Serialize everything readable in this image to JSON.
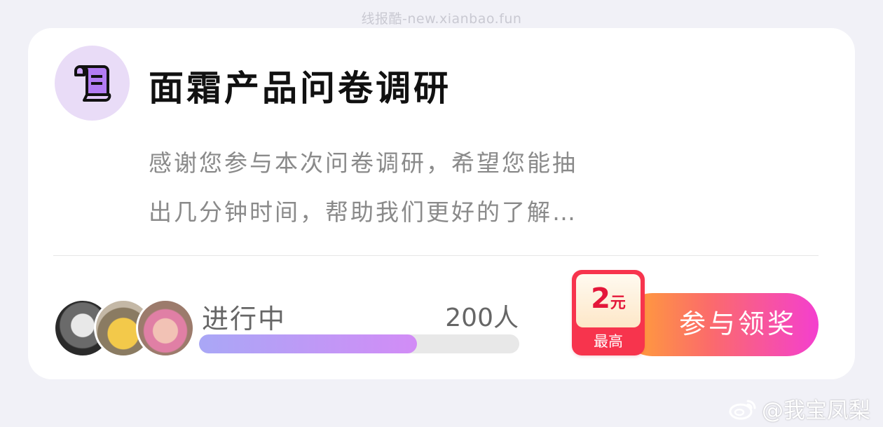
{
  "watermark_top": "线报酷-new.xianbao.fun",
  "survey": {
    "icon": "scroll-icon",
    "title": "面霜产品问卷调研",
    "description": "感谢您参与本次问卷调研，希望您能抽出几分钟时间，帮助我们更好的了解…",
    "status": "进行中",
    "participants": "200人",
    "progress_fraction": 0.68
  },
  "reward": {
    "amount": "2",
    "unit": "元",
    "caption": "最高"
  },
  "join_button": {
    "label": "参与领奖"
  },
  "colors": {
    "accent_purple": "#d28cf6",
    "button_orange": "#ffa533",
    "button_pink": "#f43fcf",
    "badge_red": "#f7344d"
  },
  "watermark_bottom": "@我宝凤梨"
}
